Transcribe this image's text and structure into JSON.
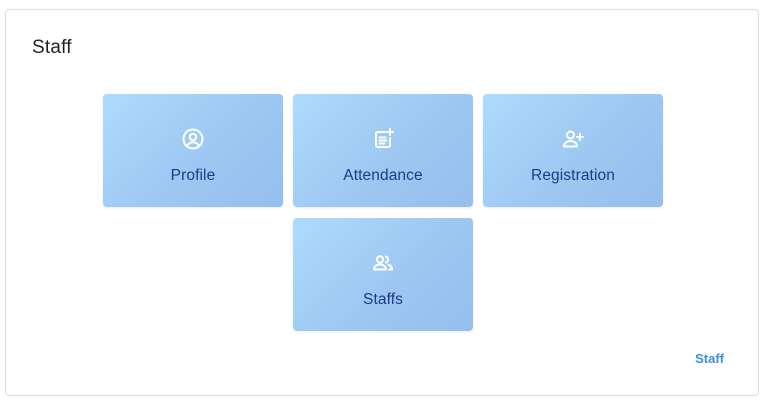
{
  "card": {
    "title": "Staff"
  },
  "tiles": [
    {
      "label": "Profile",
      "icon": "profile-circle-icon"
    },
    {
      "label": "Attendance",
      "icon": "note-add-icon"
    },
    {
      "label": "Registration",
      "icon": "person-add-icon"
    },
    {
      "label": "Staffs",
      "icon": "people-icon"
    }
  ],
  "footer": {
    "link_label": "Staff"
  },
  "colors": {
    "tile_gradient_start": "#aedbfd",
    "tile_gradient_end": "#95bfec",
    "tile_label": "#1f3a8a",
    "link": "#3d8fe0",
    "icon": "#ffffff"
  }
}
